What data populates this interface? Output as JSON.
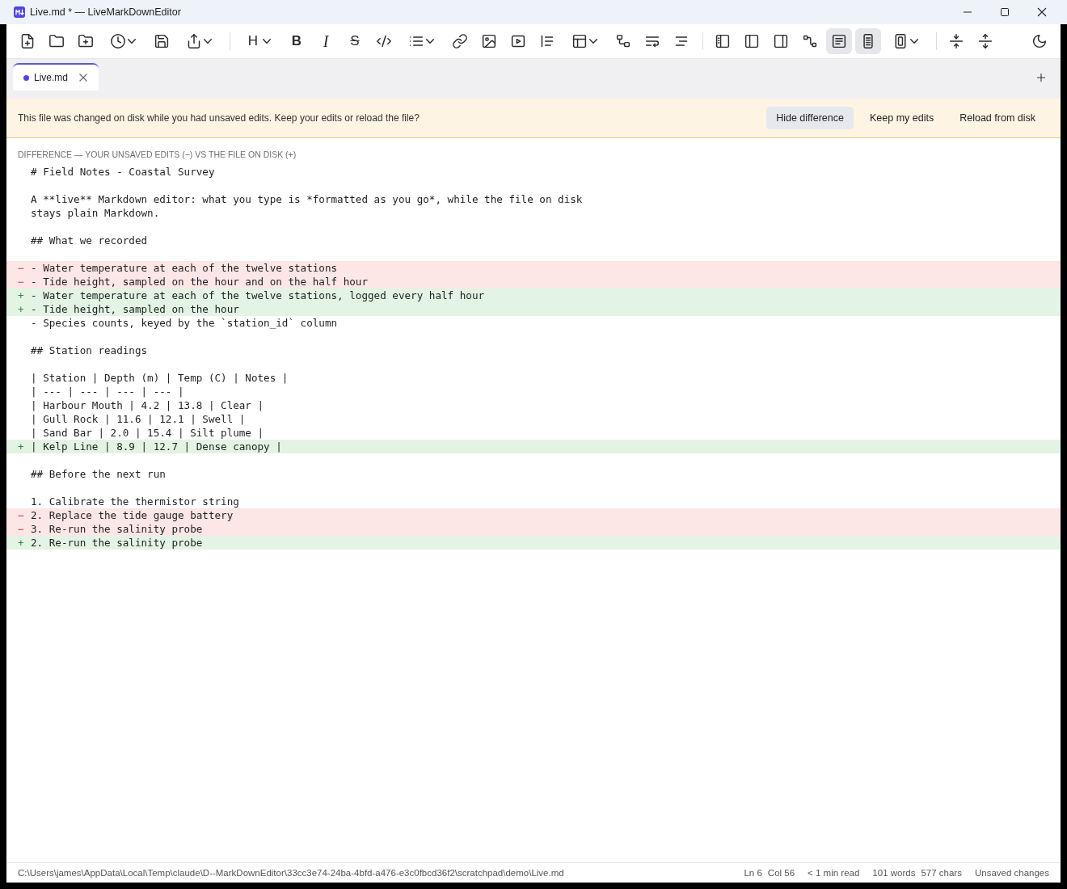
{
  "window": {
    "title": "Live.md * — LiveMarkDownEditor"
  },
  "toolbar": {
    "groups": [
      [
        {
          "dropdown": false,
          "on": false
        },
        {
          "dropdown": false,
          "on": false
        },
        {
          "dropdown": false,
          "on": false
        },
        {
          "dropdown": true,
          "on": false
        },
        {
          "dropdown": false,
          "on": false
        },
        {
          "dropdown": true,
          "on": false
        }
      ],
      [
        {
          "glyph": "H",
          "dropdown": true,
          "on": false
        },
        {
          "glyph": "B",
          "dropdown": false,
          "on": false
        },
        {
          "glyph": "I",
          "dropdown": false,
          "on": false
        },
        {
          "glyph": "S",
          "dropdown": false,
          "on": false
        },
        {
          "dropdown": false,
          "on": false
        },
        {
          "dropdown": true,
          "on": false
        },
        {
          "dropdown": false,
          "on": false
        },
        {
          "dropdown": false,
          "on": false
        },
        {
          "dropdown": false,
          "on": false
        },
        {
          "dropdown": false,
          "on": false
        },
        {
          "dropdown": true,
          "on": false
        },
        {
          "dropdown": false,
          "on": false
        },
        {
          "dropdown": false,
          "on": false
        },
        {
          "dropdown": false,
          "on": false
        }
      ],
      [
        {
          "dropdown": false,
          "on": false
        },
        {
          "dropdown": false,
          "on": false
        },
        {
          "dropdown": false,
          "on": false
        },
        {
          "dropdown": false,
          "on": false
        },
        {
          "dropdown": false,
          "on": true
        },
        {
          "dropdown": false,
          "on": true
        },
        {
          "dropdown": true,
          "on": false
        }
      ],
      [
        {
          "dropdown": false,
          "on": false
        },
        {
          "dropdown": false,
          "on": false
        }
      ]
    ],
    "end": [
      {
        "dropdown": false,
        "on": false
      }
    ]
  },
  "tabs": [
    {
      "label": "Live.md",
      "selected": true,
      "modified": true
    }
  ],
  "banner": {
    "message": "This file was changed on disk while you had unsaved edits. Keep your edits or reload the file?",
    "buttons": [
      {
        "label": "Hide difference",
        "kind": "filled"
      },
      {
        "label": "Keep my edits",
        "kind": "plain"
      },
      {
        "label": "Reload from disk",
        "kind": "plain"
      }
    ]
  },
  "diff": {
    "heading": "DIFFERENCE — YOUR UNSAVED EDITS (−) VS THE FILE ON DISK (+)",
    "lines": [
      {
        "kind": "context",
        "text": "# Field Notes - Coastal Survey"
      },
      {
        "kind": "blank"
      },
      {
        "kind": "context",
        "text": "A **live** Markdown editor: what you type is *formatted as you go*, while the file on disk"
      },
      {
        "kind": "context",
        "text": "stays plain Markdown."
      },
      {
        "kind": "blank"
      },
      {
        "kind": "context",
        "text": "## What we recorded"
      },
      {
        "kind": "blank"
      },
      {
        "kind": "removed",
        "marker": "−",
        "text": "- Water temperature at each of the twelve stations"
      },
      {
        "kind": "removed",
        "marker": "−",
        "text": "- Tide height, sampled on the hour and on the half hour"
      },
      {
        "kind": "added",
        "marker": "+",
        "text": "- Water temperature at each of the twelve stations, logged every half hour"
      },
      {
        "kind": "added",
        "marker": "+",
        "text": "- Tide height, sampled on the hour"
      },
      {
        "kind": "context",
        "text": "- Species counts, keyed by the `station_id` column"
      },
      {
        "kind": "blank"
      },
      {
        "kind": "context",
        "text": "## Station readings"
      },
      {
        "kind": "blank"
      },
      {
        "kind": "context",
        "text": "| Station | Depth (m) | Temp (C) | Notes |"
      },
      {
        "kind": "context",
        "text": "| --- | --- | --- | --- |"
      },
      {
        "kind": "context",
        "text": "| Harbour Mouth | 4.2 | 13.8 | Clear |"
      },
      {
        "kind": "context",
        "text": "| Gull Rock | 11.6 | 12.1 | Swell |"
      },
      {
        "kind": "context",
        "text": "| Sand Bar | 2.0 | 15.4 | Silt plume |"
      },
      {
        "kind": "added",
        "marker": "+",
        "text": "| Kelp Line | 8.9 | 12.7 | Dense canopy |"
      },
      {
        "kind": "blank"
      },
      {
        "kind": "context",
        "text": "## Before the next run"
      },
      {
        "kind": "blank"
      },
      {
        "kind": "context",
        "text": "1. Calibrate the thermistor string"
      },
      {
        "kind": "removed",
        "marker": "−",
        "text": "2. Replace the tide gauge battery"
      },
      {
        "kind": "removed",
        "marker": "−",
        "text": "3. Re-run the salinity probe"
      },
      {
        "kind": "added",
        "marker": "+",
        "text": "2. Re-run the salinity probe"
      }
    ]
  },
  "status_bar": {
    "path": "C:\\Users\\james\\AppData\\Local\\Temp\\claude\\D--MarkDownEditor\\33cc3e74-24ba-4bfd-a476-e3c0fbcd36f2\\scratchpad\\demo\\Live.md",
    "position": {
      "line": "Ln 6",
      "column": "Col 56"
    },
    "reading_time": "< 1 min read",
    "counts": {
      "words": "101 words",
      "chars": "577 chars"
    },
    "save_state": "Unsaved changes"
  }
}
